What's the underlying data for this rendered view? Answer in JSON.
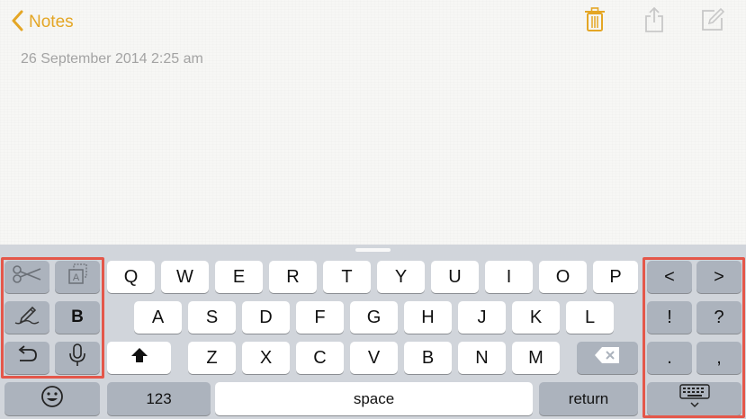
{
  "nav": {
    "back_label": "Notes"
  },
  "toolbar": {
    "trash": "trash-icon",
    "share": "share-icon",
    "compose": "compose-icon",
    "accent_color": "#e4a625"
  },
  "note": {
    "date": "26 September 2014 2:25 am"
  },
  "keyboard": {
    "row1": [
      "Q",
      "W",
      "E",
      "R",
      "T",
      "Y",
      "U",
      "I",
      "O",
      "P"
    ],
    "row2": [
      "A",
      "S",
      "D",
      "F",
      "G",
      "H",
      "J",
      "K",
      "L"
    ],
    "row3": [
      "Z",
      "X",
      "C",
      "V",
      "B",
      "N",
      "M"
    ],
    "bold_label": "B",
    "numbers_label": "123",
    "space_label": "space",
    "return_label": "return",
    "right_panel": {
      "left_arrow": "<",
      "right_arrow": ">",
      "exclamation": "!",
      "question": "?",
      "period": ".",
      "comma": ","
    }
  },
  "highlight_color": "#e4574a"
}
